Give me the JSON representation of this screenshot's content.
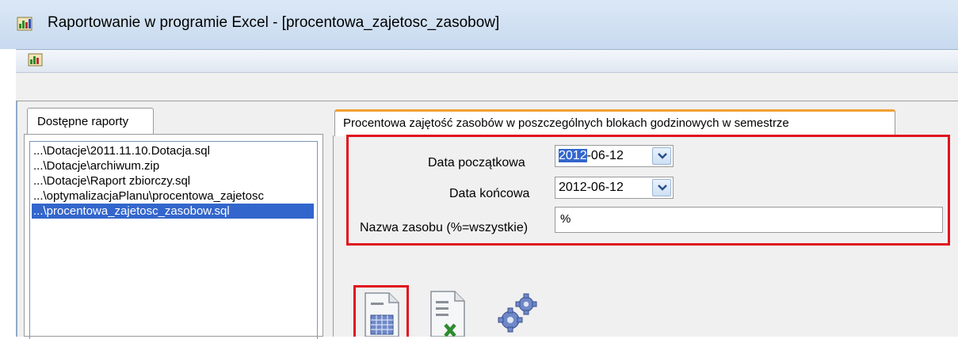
{
  "window": {
    "title": "Raportowanie w programie Excel - [procentowa_zajetosc_zasobow]",
    "icon": "excel-report-app-icon"
  },
  "left_panel": {
    "tab_label": "Dostępne raporty",
    "items": [
      {
        "label": "...\\Dotacje\\2011.11.10.Dotacja.sql",
        "selected": false
      },
      {
        "label": "...\\Dotacje\\archiwum.zip",
        "selected": false
      },
      {
        "label": "...\\Dotacje\\Raport zbiorczy.sql",
        "selected": false
      },
      {
        "label": "...\\optymalizacjaPlanu\\procentowa_zajetosc",
        "selected": false
      },
      {
        "label": "...\\procentowa_zajetosc_zasobow.sql",
        "selected": true
      }
    ]
  },
  "right_panel": {
    "tab_label": "Procentowa zajętość zasobów w poszczególnych blokach godzinowych w semestrze",
    "start_date": {
      "label": "Data początkowa",
      "value_highlight": "2012",
      "value_rest": "-06-12"
    },
    "end_date": {
      "label": "Data końcowa",
      "value": "2012-06-12"
    },
    "resource_name": {
      "label": "Nazwa zasobu (%=wszystkie)",
      "value": "%"
    },
    "actions": [
      {
        "name": "table-report-icon"
      },
      {
        "name": "excel-export-icon"
      },
      {
        "name": "settings-gears-icon"
      }
    ],
    "accent_colors": {
      "highlight_border": "#e0141e",
      "selection": "#3366cc",
      "active_tab": "#f0a030"
    }
  }
}
